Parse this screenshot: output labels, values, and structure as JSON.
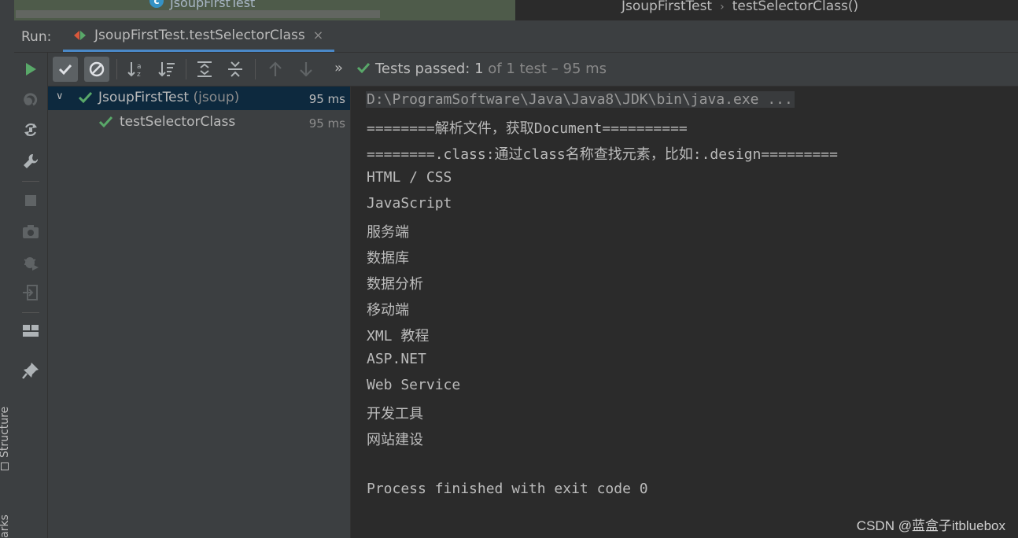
{
  "top_editor": {
    "file_label": "JsoupFirstTest",
    "breadcrumb": [
      "JsoupFirstTest",
      "testSelectorClass()"
    ]
  },
  "left_stripe": {
    "tabs": [
      "Structure",
      "arks"
    ]
  },
  "run_panel": {
    "title": "Run:",
    "tab_label": "JsoupFirstTest.testSelectorClass",
    "tab_close": "×"
  },
  "toolbar": {
    "status_passed": "Tests passed:",
    "status_count": "1",
    "status_rest": "of 1 test – 95 ms",
    "overflow": "»"
  },
  "test_tree": [
    {
      "name": "JsoupFirstTest",
      "pkg": "(jsoup)",
      "time": "95 ms",
      "selected": true,
      "expanded": true
    },
    {
      "name": "testSelectorClass",
      "pkg": "",
      "time": "95 ms",
      "selected": false
    }
  ],
  "console": {
    "lines": [
      "D:\\ProgramSoftware\\Java\\Java8\\JDK\\bin\\java.exe ...",
      "========解析文件，获取Document==========",
      "========.class:通过class名称查找元素，比如:.design=========",
      "HTML / CSS",
      "JavaScript",
      "服务端",
      "数据库",
      "数据分析",
      "移动端",
      "XML 教程",
      "ASP.NET",
      "Web Service",
      "开发工具",
      "网站建设",
      "",
      "Process finished with exit code 0"
    ]
  },
  "watermark": "CSDN @蓝盒子itbluebox",
  "colors": {
    "pass_green": "#59a869",
    "accent_blue": "#4a88c7",
    "selection": "#0d293e",
    "panel_bg": "#3c3f41",
    "console_bg": "#2b2b2b"
  }
}
